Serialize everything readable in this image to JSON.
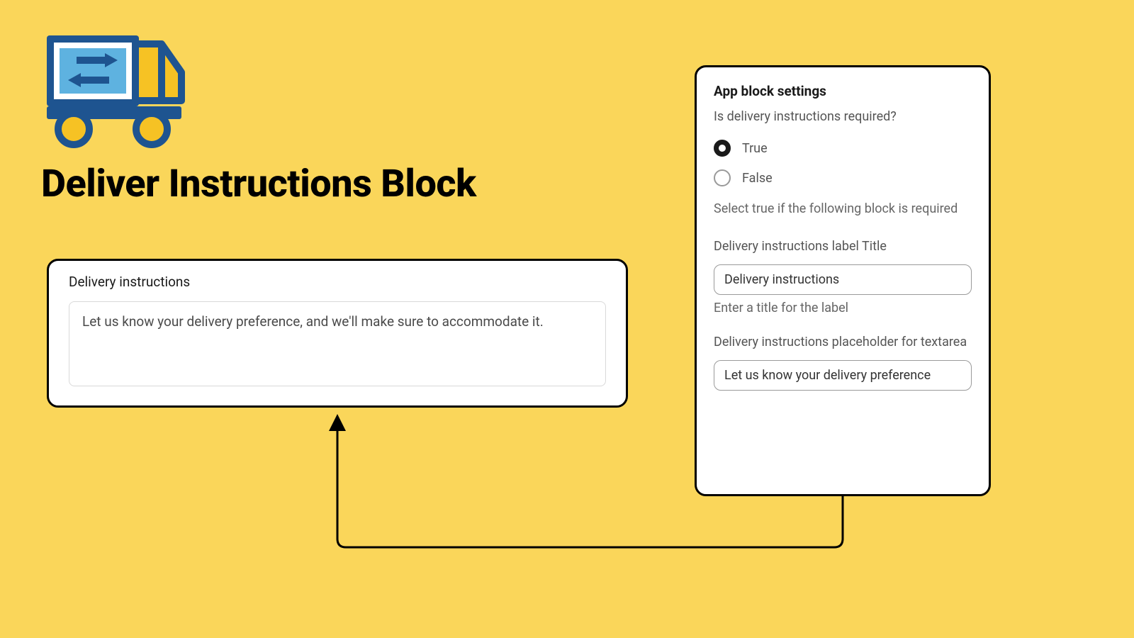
{
  "title": "Deliver Instructions Block",
  "preview": {
    "label": "Delivery instructions",
    "placeholder": "Let us know your delivery preference, and we'll make sure to accommodate it."
  },
  "settings": {
    "heading": "App block settings",
    "required_question": "Is delivery instructions required?",
    "option_true": "True",
    "option_false": "False",
    "required_help": "Select true if the following block is required",
    "label_title_label": "Delivery instructions label Title",
    "label_title_value": "Delivery instructions",
    "label_title_help": "Enter a title for the label",
    "placeholder_label": "Delivery instructions placeholder for textarea",
    "placeholder_value": "Let us know your delivery preference"
  },
  "colors": {
    "bg": "#fad65a",
    "truck_blue": "#1e5490",
    "truck_light": "#5eb2e0",
    "truck_yellow": "#f6c224"
  }
}
